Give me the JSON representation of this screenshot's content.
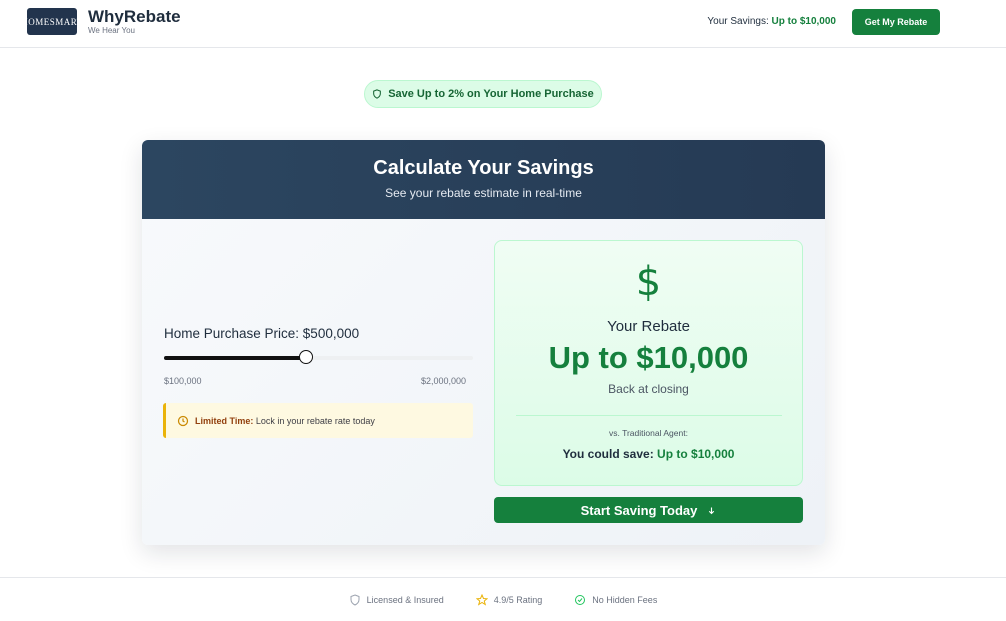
{
  "header": {
    "logo_text": "HOMESMART",
    "brand_name": "WhyRebate",
    "brand_tagline": "We Hear You",
    "savings_label": "Your Savings:",
    "savings_value": "Up to $10,000",
    "cta_label": "Get My Rebate"
  },
  "promo": {
    "pill_text": "Save Up to 2% on Your Home Purchase",
    "icon": "shield-icon"
  },
  "calculator": {
    "title": "Calculate Your Savings",
    "subtitle": "See your rebate estimate in real-time",
    "price_label": "Home Purchase Price: $500,000",
    "slider": {
      "min_label": "$100,000",
      "max_label": "$2,000,000",
      "min": 100000,
      "max": 2000000,
      "value": 500000
    },
    "notice_bold": "Limited Time:",
    "notice_text": " Lock in your rebate rate today",
    "rebate": {
      "icon": "dollar-icon",
      "label": "Your Rebate",
      "amount": "Up to $10,000",
      "sub": "Back at closing",
      "vs_label": "vs. Traditional Agent:",
      "save_label": "You could save:",
      "save_value": "Up to $10,000"
    },
    "start_button": "Start Saving Today"
  },
  "footer": {
    "items": [
      {
        "icon": "shield-icon",
        "label": "Licensed & Insured"
      },
      {
        "icon": "star-icon",
        "label": "4.9/5 Rating"
      },
      {
        "icon": "check-circle-icon",
        "label": "No Hidden Fees"
      }
    ]
  },
  "colors": {
    "brand_green": "#15803d",
    "navy": "#253a54",
    "warning": "#eab308"
  }
}
